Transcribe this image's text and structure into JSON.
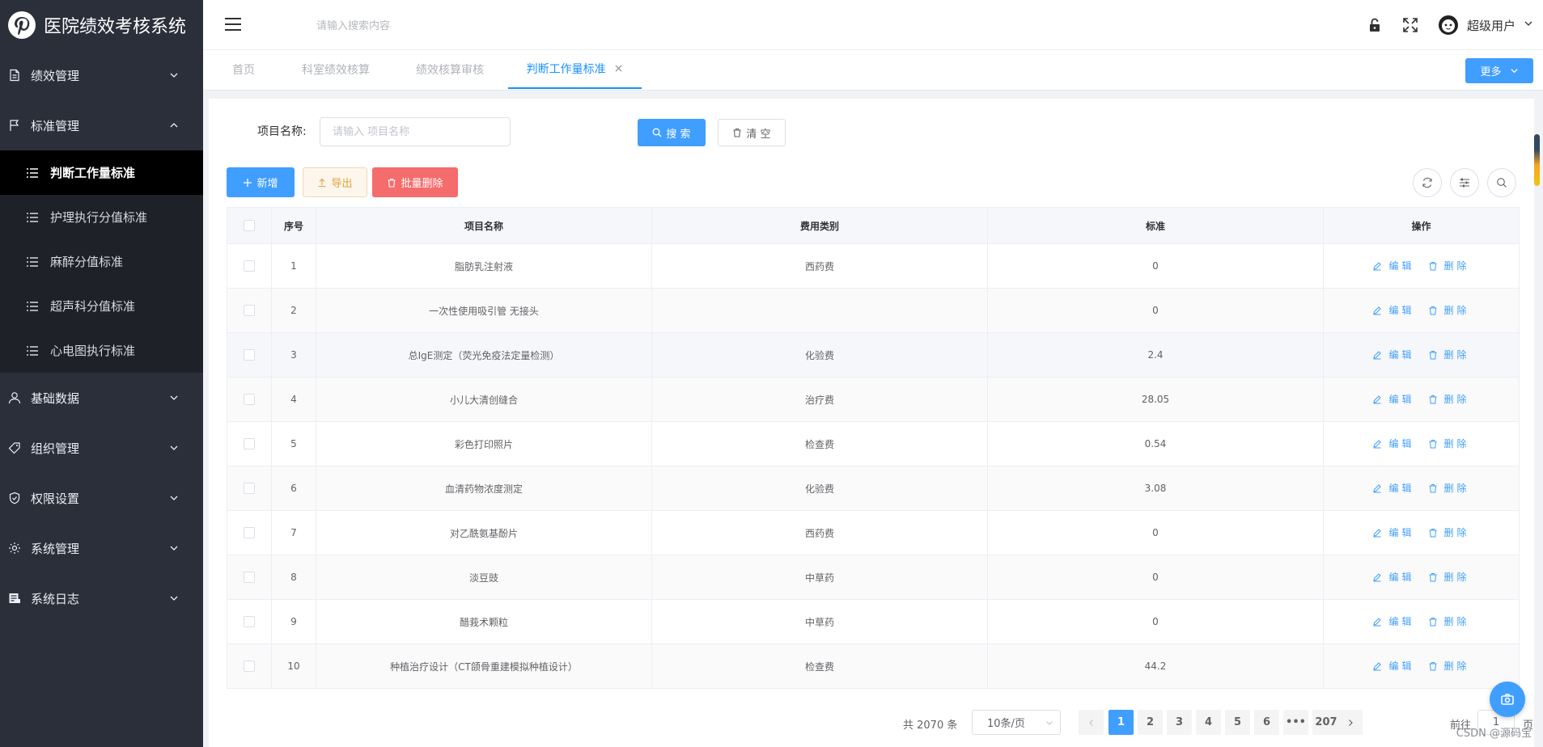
{
  "app": {
    "title": "医院绩效考核系统"
  },
  "sidebar": {
    "items": [
      {
        "label": "绩效管理",
        "icon": "document-icon",
        "expanded": false
      },
      {
        "label": "标准管理",
        "icon": "flag-icon",
        "expanded": true
      },
      {
        "label": "基础数据",
        "icon": "user-icon",
        "expanded": false
      },
      {
        "label": "组织管理",
        "icon": "tag-icon",
        "expanded": false
      },
      {
        "label": "权限设置",
        "icon": "shield-icon",
        "expanded": false
      },
      {
        "label": "系统管理",
        "icon": "gear-icon",
        "expanded": false
      },
      {
        "label": "系统日志",
        "icon": "log-icon",
        "expanded": false
      }
    ],
    "sub_items": [
      {
        "label": "判断工作量标准",
        "active": true
      },
      {
        "label": "护理执行分值标准",
        "active": false
      },
      {
        "label": "麻醉分值标准",
        "active": false
      },
      {
        "label": "超声科分值标准",
        "active": false
      },
      {
        "label": "心电图执行标准",
        "active": false
      }
    ]
  },
  "header": {
    "search_placeholder": "请输入搜索内容",
    "user_name": "超级用户"
  },
  "tabs": {
    "items": [
      {
        "label": "首页",
        "active": false
      },
      {
        "label": "科室绩效核算",
        "active": false
      },
      {
        "label": "绩效核算审核",
        "active": false
      },
      {
        "label": "判断工作量标准",
        "active": true,
        "close": "×"
      }
    ],
    "more_label": "更多"
  },
  "filter": {
    "label": "项目名称:",
    "placeholder": "请输入 项目名称",
    "search_label": "搜 索",
    "clear_label": "清 空"
  },
  "toolbar": {
    "add_label": "新增",
    "export_label": "导出",
    "bulk_delete_label": "批量删除"
  },
  "table": {
    "headers": [
      "序号",
      "项目名称",
      "费用类别",
      "标准",
      "操作"
    ],
    "edit_label": "编辑",
    "delete_label": "删除",
    "rows": [
      {
        "no": "1",
        "name": "脂肪乳注射液",
        "category": "西药费",
        "standard": "0"
      },
      {
        "no": "2",
        "name": "一次性使用吸引管 无接头",
        "category": "",
        "standard": "0"
      },
      {
        "no": "3",
        "name": "总IgE测定（荧光免疫法定量检测）",
        "category": "化验费",
        "standard": "2.4"
      },
      {
        "no": "4",
        "name": "小儿大清创缝合",
        "category": "治疗费",
        "standard": "28.05"
      },
      {
        "no": "5",
        "name": "彩色打印照片",
        "category": "检查费",
        "standard": "0.54"
      },
      {
        "no": "6",
        "name": "血清药物浓度测定",
        "category": "化验费",
        "standard": "3.08"
      },
      {
        "no": "7",
        "name": "对乙酰氨基酚片",
        "category": "西药费",
        "standard": "0"
      },
      {
        "no": "8",
        "name": "淡豆豉",
        "category": "中草药",
        "standard": "0"
      },
      {
        "no": "9",
        "name": "醋莪术颗粒",
        "category": "中草药",
        "standard": "0"
      },
      {
        "no": "10",
        "name": "种植治疗设计（CT颌骨重建模拟种植设计）",
        "category": "检查费",
        "standard": "44.2"
      }
    ]
  },
  "pagination": {
    "total_text": "共 2070 条",
    "page_size": "10条/页",
    "pages": [
      "1",
      "2",
      "3",
      "4",
      "5",
      "6",
      "•••",
      "207"
    ],
    "current_page": "1",
    "goto_prefix": "前往",
    "goto_value": "1",
    "goto_suffix": "页"
  },
  "watermark": "CSDN @源码宝",
  "colors": {
    "primary": "#409eff",
    "danger": "#f56c6c",
    "warning": "#e6a23c",
    "sidebar_bg": "#2b2f3a",
    "sidebar_active_bg": "#000000"
  }
}
